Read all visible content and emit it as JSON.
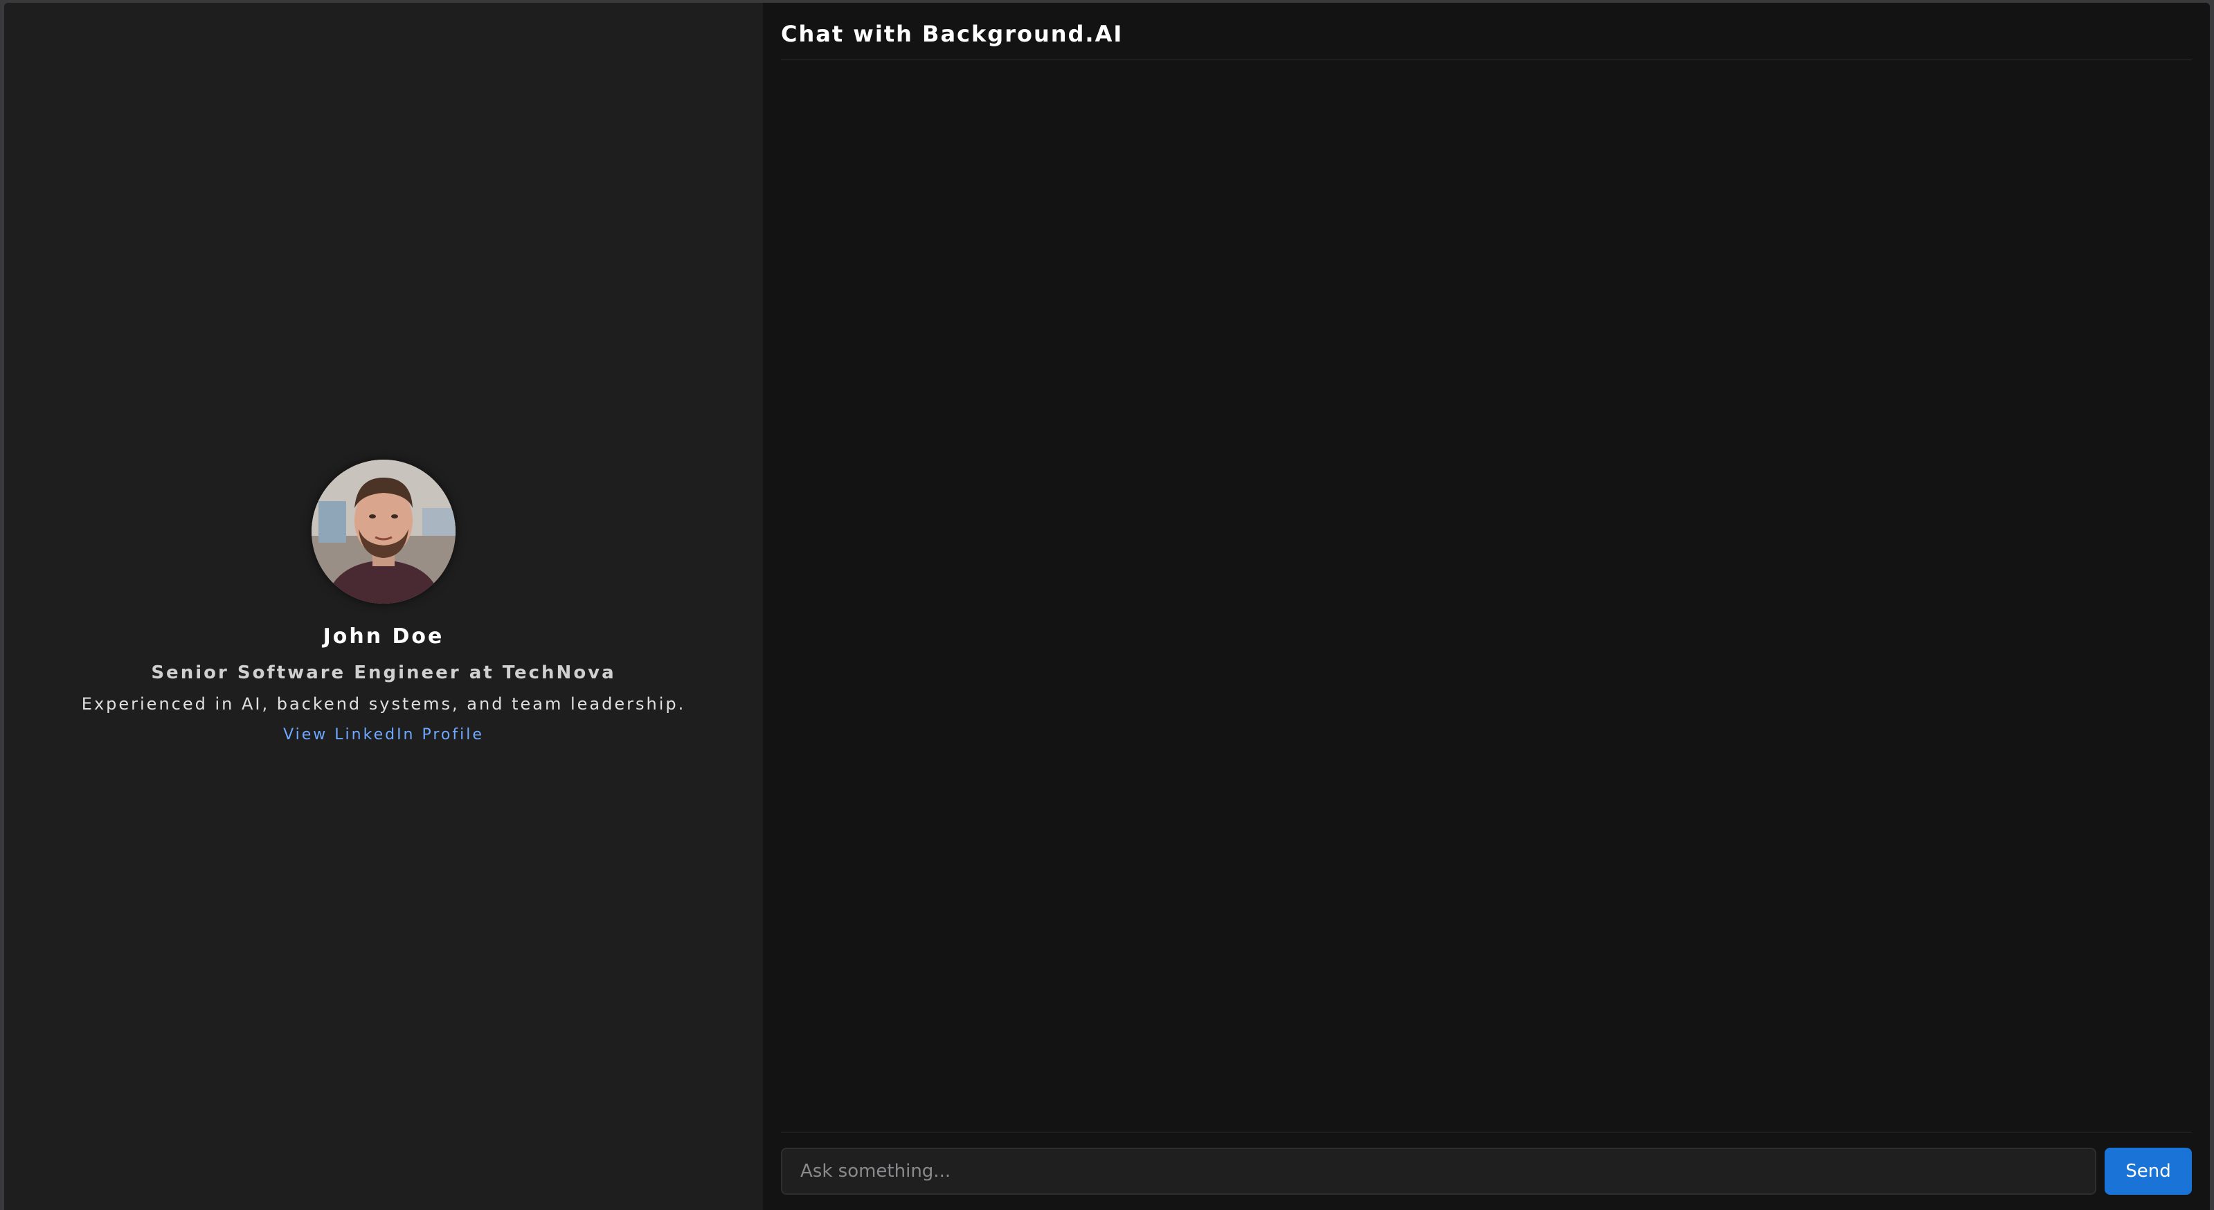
{
  "profile": {
    "name": "John Doe",
    "title": "Senior Software Engineer at TechNova",
    "bio": "Experienced in AI, backend systems, and team leadership.",
    "linkedin_label": "View LinkedIn Profile"
  },
  "chat": {
    "title": "Chat with Background.AI",
    "input_placeholder": "Ask something...",
    "input_value": "",
    "send_label": "Send"
  },
  "colors": {
    "accent": "#1a74d8",
    "link": "#6fa8ff",
    "sidebar_bg": "#1e1e1f",
    "chat_bg": "#131314"
  },
  "icons": {
    "avatar": "profile-photo"
  }
}
